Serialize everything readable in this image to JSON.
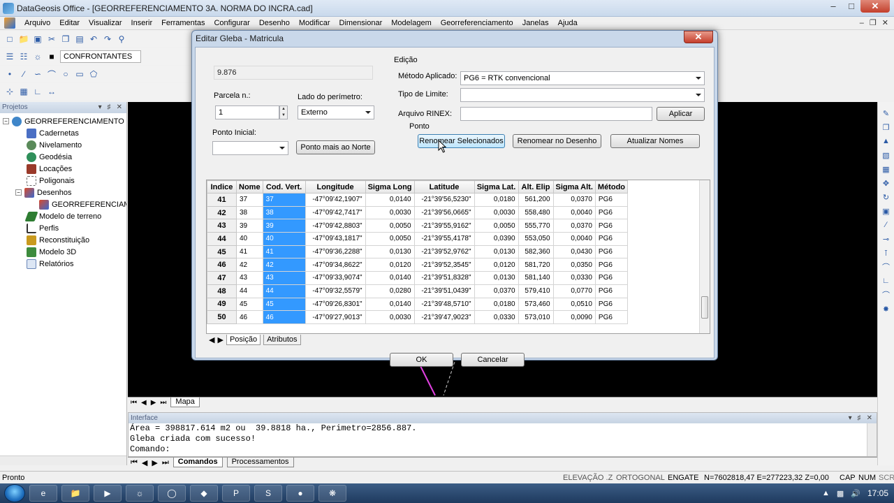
{
  "app": {
    "title": "DataGeosis Office - [GEORREFERENCIAMENTO 3A. NORMA DO INCRA.cad]",
    "menus": [
      "Arquivo",
      "Editar",
      "Visualizar",
      "Inserir",
      "Ferramentas",
      "Configurar",
      "Desenho",
      "Modificar",
      "Dimensionar",
      "Modelagem",
      "Georreferenciamento",
      "Janelas",
      "Ajuda"
    ],
    "layer_select": "CONFRONTANTES"
  },
  "projects": {
    "title": "Projetos",
    "nodes": [
      {
        "label": "GEORREFERENCIAMENTO -",
        "level": 0,
        "icon": "globe-icon"
      },
      {
        "label": "Cadernetas",
        "level": 1,
        "icon": "notebook-icon"
      },
      {
        "label": "Nivelamento",
        "level": 1,
        "icon": "level-icon"
      },
      {
        "label": "Geodésia",
        "level": 1,
        "icon": "geodesy-icon"
      },
      {
        "label": "Locações",
        "level": 1,
        "icon": "stakeout-icon"
      },
      {
        "label": "Poligonais",
        "level": 1,
        "icon": "polygonal-icon"
      },
      {
        "label": "Desenhos",
        "level": 1,
        "icon": "drawings-icon"
      },
      {
        "label": "GEORREFERENCIAMI",
        "level": 2,
        "icon": "drawing-file-icon"
      },
      {
        "label": "Modelo de terreno",
        "level": 1,
        "icon": "terrain-icon"
      },
      {
        "label": "Perfis",
        "level": 1,
        "icon": "profile-icon"
      },
      {
        "label": "Reconstituição",
        "level": 1,
        "icon": "reconstruction-icon"
      },
      {
        "label": "Modelo 3D",
        "level": 1,
        "icon": "model3d-icon"
      },
      {
        "label": "Relatórios",
        "level": 1,
        "icon": "reports-icon"
      }
    ]
  },
  "map_tab": "Mapa",
  "interface": {
    "title": "Interface",
    "lines": [
      "Área = 398817.614 m2 ou  39.8818 ha., Perimetro=2856.887.",
      "Gleba criada com sucesso!",
      "Comando:"
    ],
    "tabs": [
      "Comandos",
      "Processamentos"
    ]
  },
  "status": {
    "left": "Pronto",
    "elevacao": "ELEVAÇÃO .Z",
    "ortogonal": "ORTOGONAL",
    "engate": "ENGATE",
    "coords": "N=7602818,47 E=277223,32 Z=0,00",
    "cap": "CAP",
    "num": "NUM",
    "scr": "SCR"
  },
  "taskbar": {
    "clock": "17:05"
  },
  "dialog": {
    "title": "Editar Gleba - Matricula",
    "area_value": "9.876",
    "parcela_label": "Parcela n.:",
    "parcela_value": "1",
    "lado_label": "Lado do perímetro:",
    "lado_value": "Externo",
    "ponto_inicial_label": "Ponto Inicial:",
    "ponto_norte_btn": "Ponto mais ao Norte",
    "edicao_label": "Edição",
    "metodo_label": "Método Aplicado:",
    "metodo_value": "PG6 = RTK convencional",
    "tipo_limite_label": "Tipo de Limite:",
    "rinex_label": "Arquivo RINEX:",
    "aplicar_btn": "Aplicar",
    "ponto_label": "Ponto",
    "renomear_sel_btn": "Renomear Selecionados",
    "renomear_desenho_btn": "Renomear no Desenho",
    "atualizar_btn": "Atualizar Nomes",
    "ok_btn": "OK",
    "cancelar_btn": "Cancelar",
    "grid_tabs": [
      "Posição",
      "Atributos"
    ],
    "columns": [
      "Indice",
      "Nome",
      "Cod. Vert.",
      "Longitude",
      "Sigma Long",
      "Latitude",
      "Sigma Lat.",
      "Alt. Elip",
      "Sigma Alt.",
      "Método"
    ],
    "rows": [
      [
        "41",
        "37",
        "37",
        "-47°09'42,1907\"",
        "0,0140",
        "-21°39'56,5230\"",
        "0,0180",
        "561,200",
        "0,0370",
        "PG6"
      ],
      [
        "42",
        "38",
        "38",
        "-47°09'42,7417\"",
        "0,0030",
        "-21°39'56,0665\"",
        "0,0030",
        "558,480",
        "0,0040",
        "PG6"
      ],
      [
        "43",
        "39",
        "39",
        "-47°09'42,8803\"",
        "0,0050",
        "-21°39'55,9162\"",
        "0,0050",
        "555,770",
        "0,0370",
        "PG6"
      ],
      [
        "44",
        "40",
        "40",
        "-47°09'43,1817\"",
        "0,0050",
        "-21°39'55,4178\"",
        "0,0390",
        "553,050",
        "0,0040",
        "PG6"
      ],
      [
        "45",
        "41",
        "41",
        "-47°09'36,2288\"",
        "0,0130",
        "-21°39'52,9762\"",
        "0,0130",
        "582,360",
        "0,0430",
        "PG6"
      ],
      [
        "46",
        "42",
        "42",
        "-47°09'34,8622\"",
        "0,0120",
        "-21°39'52,3545\"",
        "0,0120",
        "581,720",
        "0,0350",
        "PG6"
      ],
      [
        "47",
        "43",
        "43",
        "-47°09'33,9074\"",
        "0,0140",
        "-21°39'51,8328\"",
        "0,0130",
        "581,140",
        "0,0330",
        "PG6"
      ],
      [
        "48",
        "44",
        "44",
        "-47°09'32,5579\"",
        "0,0280",
        "-21°39'51,0439\"",
        "0,0370",
        "579,410",
        "0,0770",
        "PG6"
      ],
      [
        "49",
        "45",
        "45",
        "-47°09'26,8301\"",
        "0,0140",
        "-21°39'48,5710\"",
        "0,0180",
        "573,460",
        "0,0510",
        "PG6"
      ],
      [
        "50",
        "46",
        "46",
        "-47°09'27,9013\"",
        "0,0030",
        "-21°39'47,9023\"",
        "0,0330",
        "573,010",
        "0,0090",
        "PG6"
      ]
    ]
  }
}
